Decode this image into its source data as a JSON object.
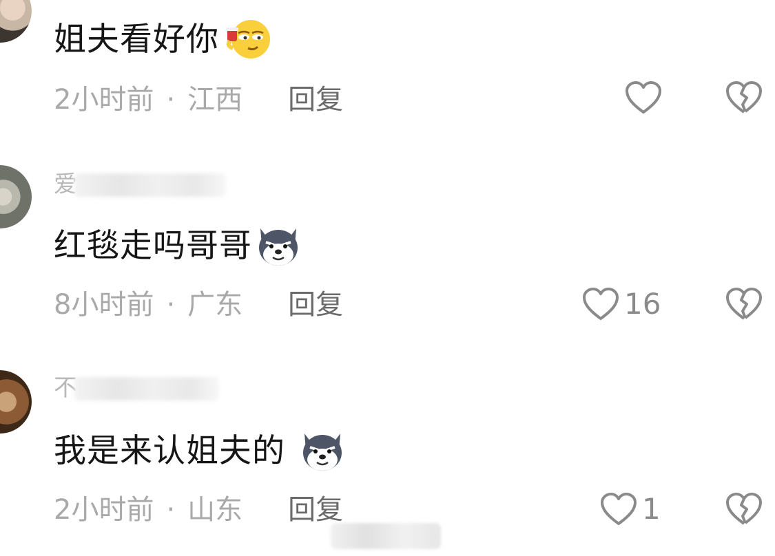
{
  "comments": [
    {
      "username": "",
      "text": "姐夫看好你",
      "emoji": "drinking-smirk-emoji",
      "time": "2小时前",
      "location": "江西",
      "reply_label": "回复",
      "likes": ""
    },
    {
      "username": "爱",
      "text": "红毯走吗哥哥",
      "emoji": "husky-dog-emoji",
      "time": "8小时前",
      "location": "广东",
      "reply_label": "回复",
      "likes": "16"
    },
    {
      "username": "不",
      "text": "我是来认姐夫的",
      "emoji": "husky-dog-emoji",
      "time": "2小时前",
      "location": "山东",
      "reply_label": "回复",
      "likes": "1"
    }
  ],
  "separator": "·",
  "colors": {
    "text": "#161616",
    "meta": "#a9a9a9",
    "reply": "#6b6b6b",
    "icon": "#8a8a8a"
  }
}
